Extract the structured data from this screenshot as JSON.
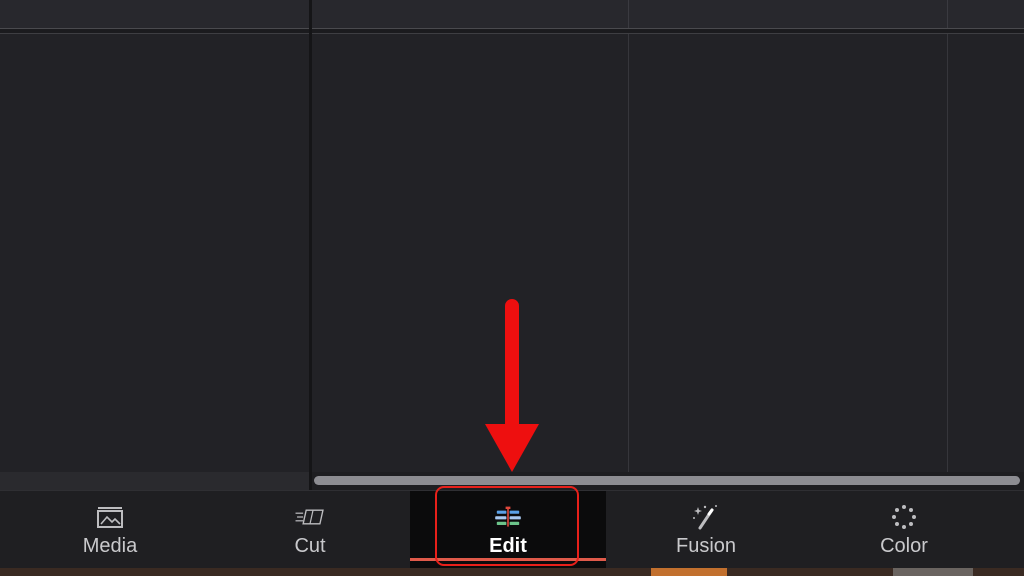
{
  "page_tabs": [
    {
      "label": "Media",
      "icon": "media-icon"
    },
    {
      "label": "Cut",
      "icon": "cut-icon"
    },
    {
      "label": "Edit",
      "icon": "edit-icon",
      "active": true
    },
    {
      "label": "Fusion",
      "icon": "fusion-icon"
    },
    {
      "label": "Color",
      "icon": "color-icon"
    }
  ],
  "colors": {
    "background": "#222226",
    "active_underline": "#e05a4a",
    "highlight": "#e8201a",
    "annotation_arrow": "#ee0f0f"
  }
}
